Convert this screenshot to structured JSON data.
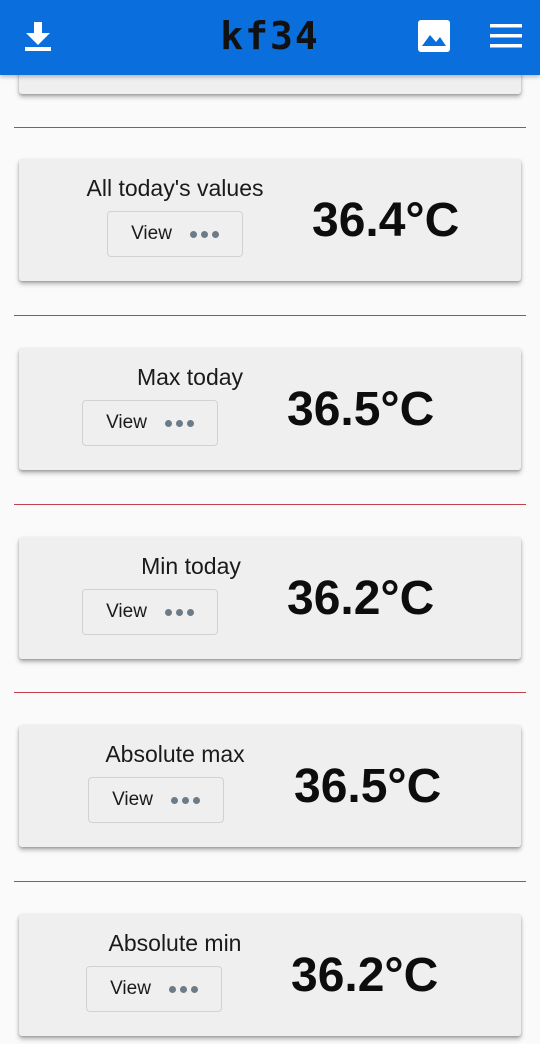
{
  "app": {
    "title": "kf34",
    "icons": {
      "download": "download-icon",
      "image": "image-icon",
      "menu": "menu-icon"
    },
    "colors": {
      "appbar": "#0a6fdc",
      "divider": "#c4404c",
      "card": "#efefef"
    }
  },
  "cards": [
    {
      "label": "All today's values",
      "button": "View",
      "value": "36.4°C"
    },
    {
      "label": "Max today",
      "button": "View",
      "value": "36.5°C"
    },
    {
      "label": "Min today",
      "button": "View",
      "value": "36.2°C"
    },
    {
      "label": "Absolute max",
      "button": "View",
      "value": "36.5°C"
    },
    {
      "label": "Absolute min",
      "button": "View",
      "value": "36.2°C"
    }
  ]
}
